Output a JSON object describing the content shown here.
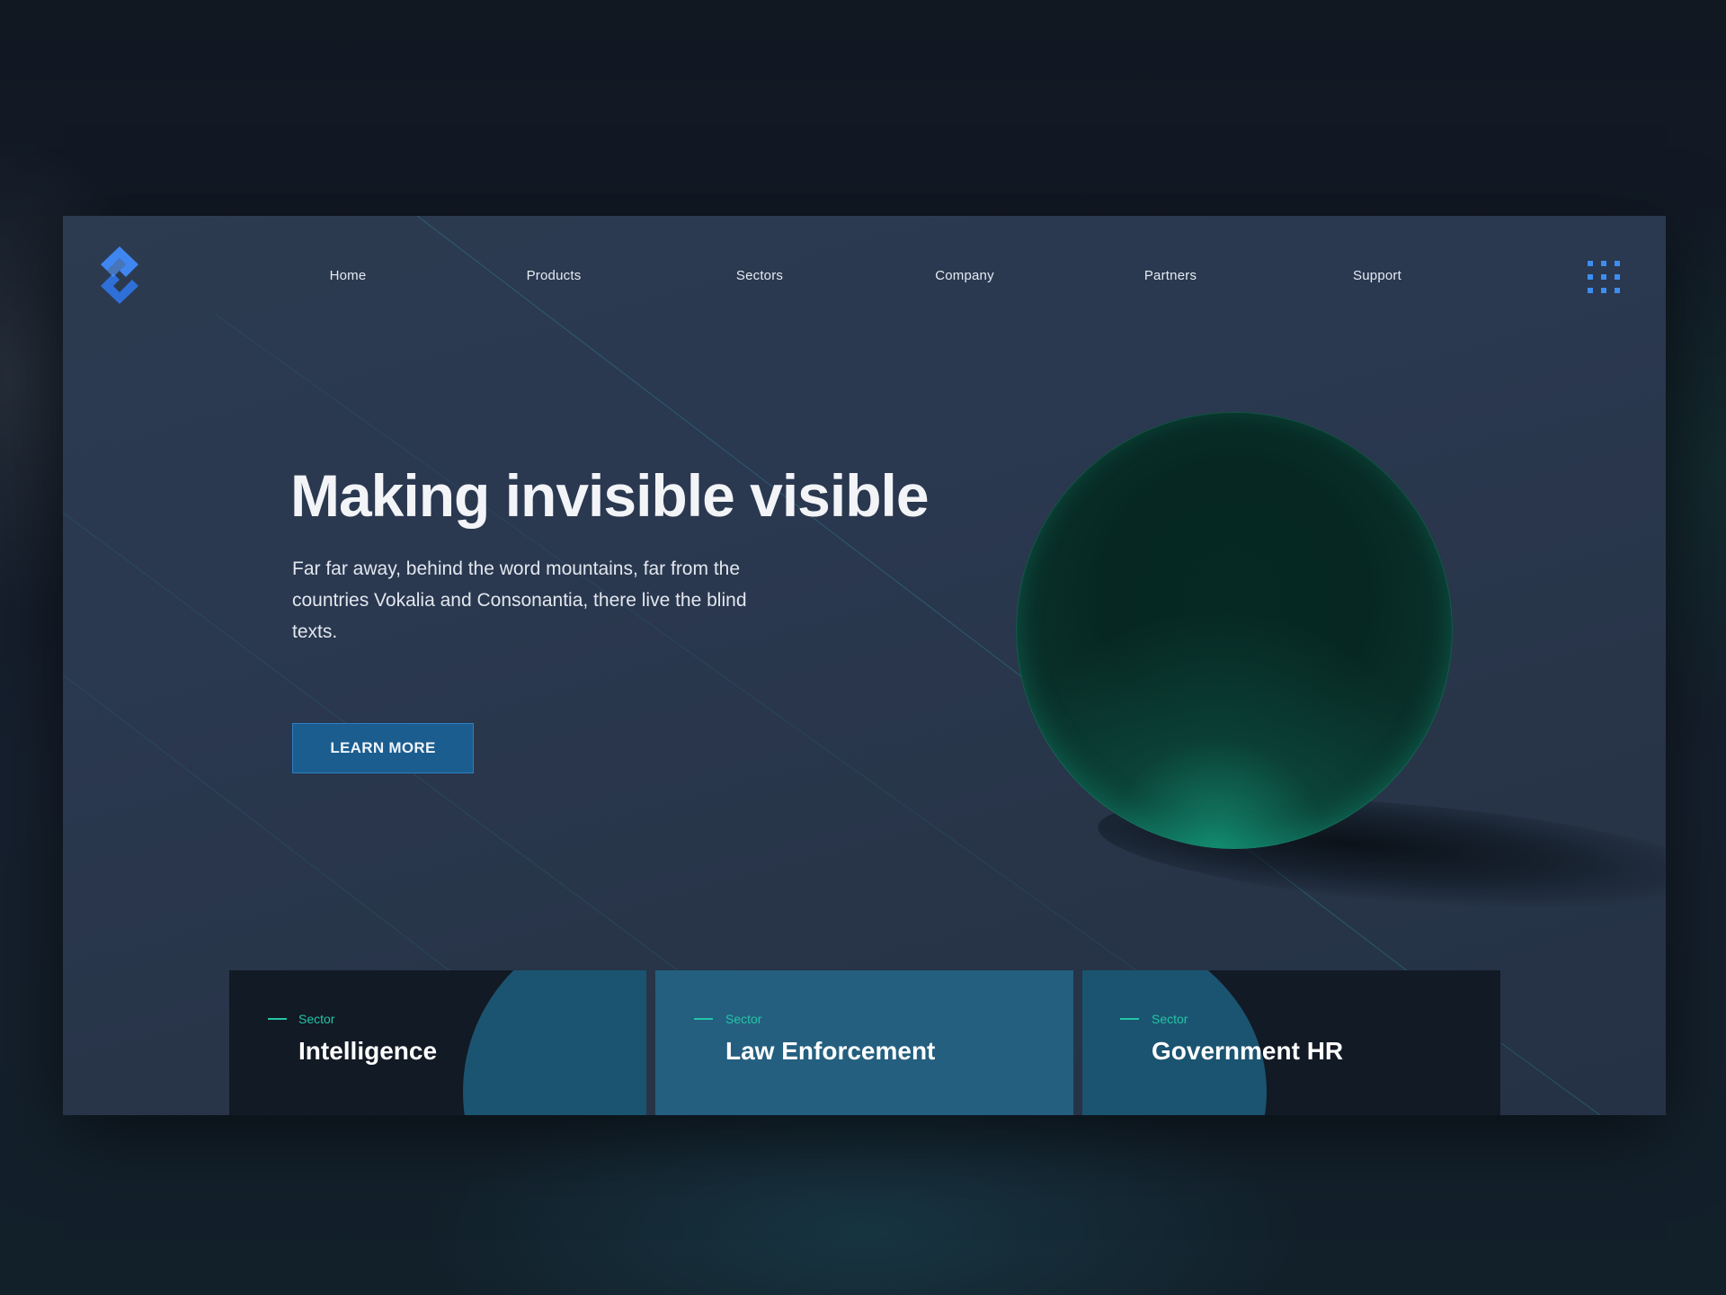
{
  "brand": {
    "logo_icon": "diamond-s-logo-icon",
    "accent_color": "#3d8ef0"
  },
  "nav": {
    "items": [
      {
        "label": "Home"
      },
      {
        "label": "Products"
      },
      {
        "label": "Sectors"
      },
      {
        "label": "Company"
      },
      {
        "label": "Partners"
      },
      {
        "label": "Support"
      }
    ],
    "menu_icon": "grid-menu-icon"
  },
  "hero": {
    "headline": "Making invisible visible",
    "subtext": "Far far away, behind the word mountains, far from the countries Vokalia and Consonantia, there live the blind texts.",
    "cta_label": "LEARN MORE"
  },
  "sectors": {
    "tag_color": "#23c5a6",
    "cards": [
      {
        "tag": "Sector",
        "title": "Intelligence"
      },
      {
        "tag": "Sector",
        "title": "Law Enforcement"
      },
      {
        "tag": "Sector",
        "title": "Government HR"
      }
    ]
  }
}
